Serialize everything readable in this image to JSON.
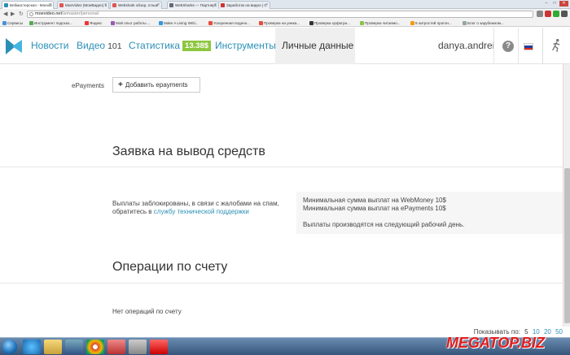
{
  "browser": {
    "tabs": [
      {
        "label": "Вебмастерская - Moevid",
        "color": "#2a8fb6",
        "active": true
      },
      {
        "label": "MoeVideo (МоеВидео) о",
        "color": "#d55"
      },
      {
        "label": "Webshark обзор, отзыв",
        "color": "#d55"
      },
      {
        "label": "WebSharks — Партнерс",
        "color": "#667"
      },
      {
        "label": "Заработок на видео | С",
        "color": "#c33"
      }
    ],
    "address": {
      "host": "moevideo.net",
      "path": "/wmaster/personal"
    },
    "bookmarks": [
      {
        "label": "Сервисы",
        "color": "#4a90d9"
      },
      {
        "label": "Инструмент подсказ...",
        "color": "#5a5"
      },
      {
        "label": "Яндекс",
        "color": "#e33"
      },
      {
        "label": "Мой опыт работы ...",
        "color": "#9b59b6"
      },
      {
        "label": "Make A Living Writi...",
        "color": "#3498db"
      },
      {
        "label": "Ускоренная подача...",
        "color": "#e74c3c"
      },
      {
        "label": "Проверка на уника...",
        "color": "#e74c3c"
      },
      {
        "label": "Проверка орфогра...",
        "color": "#333"
      },
      {
        "label": "Проверка читаемо...",
        "color": "#8bc34a"
      },
      {
        "label": "9 хитростей прогон...",
        "color": "#f39c12"
      },
      {
        "label": "Блог о зарубежном...",
        "color": "#95a5a6"
      }
    ]
  },
  "header": {
    "nav": [
      {
        "label": "Новости"
      },
      {
        "label": "Видео",
        "count": "101"
      },
      {
        "label": "Статистика",
        "badge": "13.38$"
      },
      {
        "label": "Инструменты"
      },
      {
        "label": "Личные данные",
        "active": true
      }
    ],
    "username": "danya.andrei",
    "help_label": "?"
  },
  "main": {
    "epayments_label": "ePayments",
    "add_epayments": "Добавить epayments",
    "withdraw_title": "Заявка на вывод средств",
    "blocked_text": "Выплаты заблокированы, в связи с жалобами на спам, обратитесь в ",
    "support_link": "службу технической поддержки",
    "info_lines": [
      "Минимальная сумма выплат на WebMoney 10$",
      "Минимальная сумма выплат на ePayments 10$",
      "",
      "Выплаты производятся на следующий рабочий день."
    ],
    "operations_title": "Операции по счету",
    "no_operations": "Нет операций по счету"
  },
  "paging": {
    "label": "Показывать по:",
    "options": [
      "5",
      "10",
      "20",
      "50"
    ]
  },
  "watermark": "MEGATOP.BIZ"
}
